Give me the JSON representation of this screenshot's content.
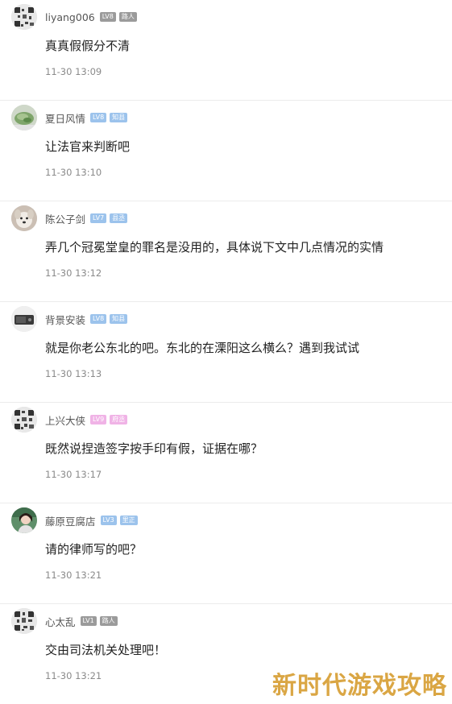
{
  "comments": [
    {
      "username": "liyang006",
      "level": "LV8",
      "tag": "路人",
      "level_color": "#9b9b9b",
      "tag_color": "#9b9b9b",
      "text": "真真假假分不清",
      "time": "11-30 13:09",
      "avatar_icon": "qr-pattern-avatar"
    },
    {
      "username": "夏日风情",
      "level": "LV8",
      "tag": "知县",
      "level_color": "#9cc3ec",
      "tag_color": "#9cc3ec",
      "text": "让法官来判断吧",
      "time": "11-30 13:10",
      "avatar_icon": "plant-photo-avatar"
    },
    {
      "username": "陈公子剑",
      "level": "LV7",
      "tag": "县丞",
      "level_color": "#9cc3ec",
      "tag_color": "#9cc3ec",
      "text": "弄几个冠冕堂皇的罪名是没用的，具体说下文中几点情况的实情",
      "time": "11-30 13:12",
      "avatar_icon": "dog-photo-avatar"
    },
    {
      "username": "背景安装",
      "level": "LV8",
      "tag": "知县",
      "level_color": "#9cc3ec",
      "tag_color": "#9cc3ec",
      "text": "就是你老公东北的吧。东北的在溧阳这么横么？遇到我试试",
      "time": "11-30 13:13",
      "avatar_icon": "device-photo-avatar"
    },
    {
      "username": "上兴大侠",
      "level": "LV9",
      "tag": "府丞",
      "level_color": "#f0b3e6",
      "tag_color": "#f0b3e6",
      "text": "既然说捏造签字按手印有假，证据在哪？",
      "time": "11-30 13:17",
      "avatar_icon": "qr-pattern-avatar"
    },
    {
      "username": "藤原豆腐店",
      "level": "LV3",
      "tag": "里正",
      "level_color": "#9cc3ec",
      "tag_color": "#9cc3ec",
      "text": "请的律师写的吧？",
      "time": "11-30 13:21",
      "avatar_icon": "person-photo-avatar"
    },
    {
      "username": "心太乱",
      "level": "LV1",
      "tag": "路人",
      "level_color": "#9b9b9b",
      "tag_color": "#9b9b9b",
      "text": "交由司法机关处理吧！",
      "time": "11-30 13:21",
      "avatar_icon": "qr-pattern-avatar"
    }
  ],
  "watermark": "新时代游戏攻略"
}
